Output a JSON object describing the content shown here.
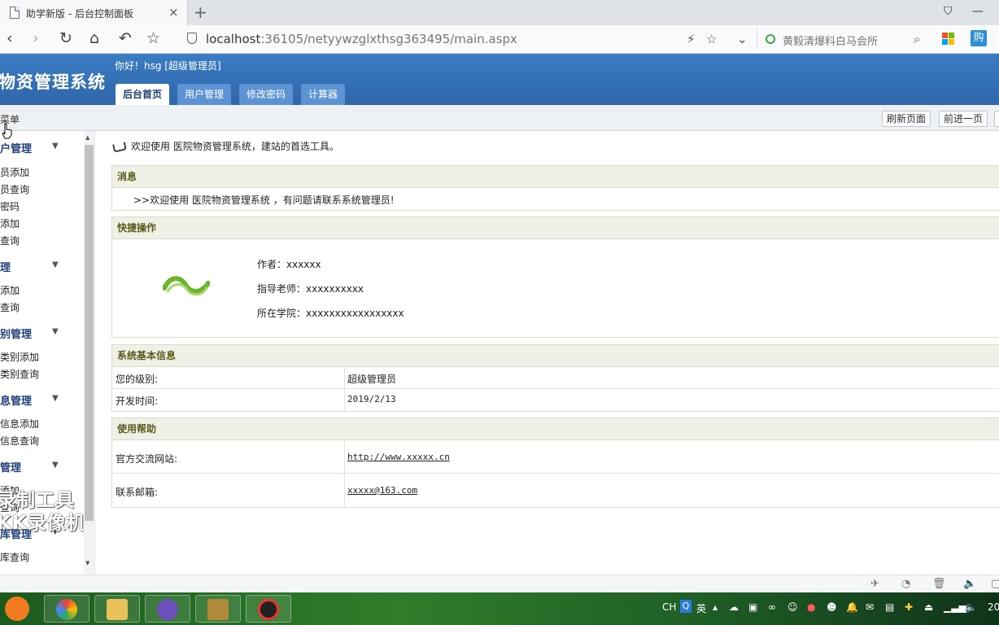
{
  "browser": {
    "tab_title": "助学新版 - 后台控制面板",
    "tab_close": "×",
    "new_tab": "+",
    "url_host": "localhost",
    "url_rest": ":36105/netyywzglxthsg363495/main.aspx",
    "search_placeholder": "黄毅清爆料白马会所",
    "gou_label": "购"
  },
  "header": {
    "app_title": "物资管理系统",
    "greeting": "你好！hsg [超级管理员]",
    "tabs": [
      {
        "label": "后台首页",
        "active": true
      },
      {
        "label": "用户管理"
      },
      {
        "label": "修改密码"
      },
      {
        "label": "计算器"
      }
    ]
  },
  "toolbar": {
    "menu_label": "菜单",
    "refresh": "刷新页面",
    "forward": "前进一页"
  },
  "sidebar": {
    "groups": [
      {
        "title": "户管理",
        "items": [
          "员添加",
          "员查询",
          "密码",
          "添加",
          "查询"
        ]
      },
      {
        "title": "理",
        "items": [
          "添加",
          "查询"
        ]
      },
      {
        "title": "别管理",
        "items": [
          "类别添加",
          "类别查询"
        ]
      },
      {
        "title": "息管理",
        "items": [
          "信息添加",
          "信息查询"
        ]
      },
      {
        "title": "管理",
        "items": [
          "添加",
          "查询"
        ]
      },
      {
        "title": "库管理",
        "items": [
          "库查询"
        ]
      }
    ],
    "watermark_1": "录制工具",
    "watermark_2": "KK录像机"
  },
  "main": {
    "welcome": "欢迎使用 医院物资管理系统，建站的首选工具。",
    "message_title": "消息",
    "message_text": ">>欢迎使用 医院物资管理系统 ，有问题请联系系统管理员!",
    "quick_title": "快捷操作",
    "author": "作者：xxxxxx",
    "advisor": "指导老师：xxxxxxxxxx",
    "college": "所在学院：xxxxxxxxxxxxxxxxx",
    "info_title": "系统基本信息",
    "level_label": "您的级别:",
    "level_value": "超级管理员",
    "dev_label": "开发时间:",
    "dev_value": "2019/2/13",
    "help_title": "使用帮助",
    "site_label": "官方交流网站:",
    "site_value": "http://www.xxxxx.cn",
    "mail_label": "联系邮箱:",
    "mail_value": "xxxxx@163.com"
  },
  "taskbar": {
    "lang": "CH",
    "ime": "英",
    "clock": "20"
  },
  "colors": {
    "header_blue": "#3773b8",
    "panel_head": "#f0f1e6",
    "panel_title": "#5b5b1e"
  }
}
